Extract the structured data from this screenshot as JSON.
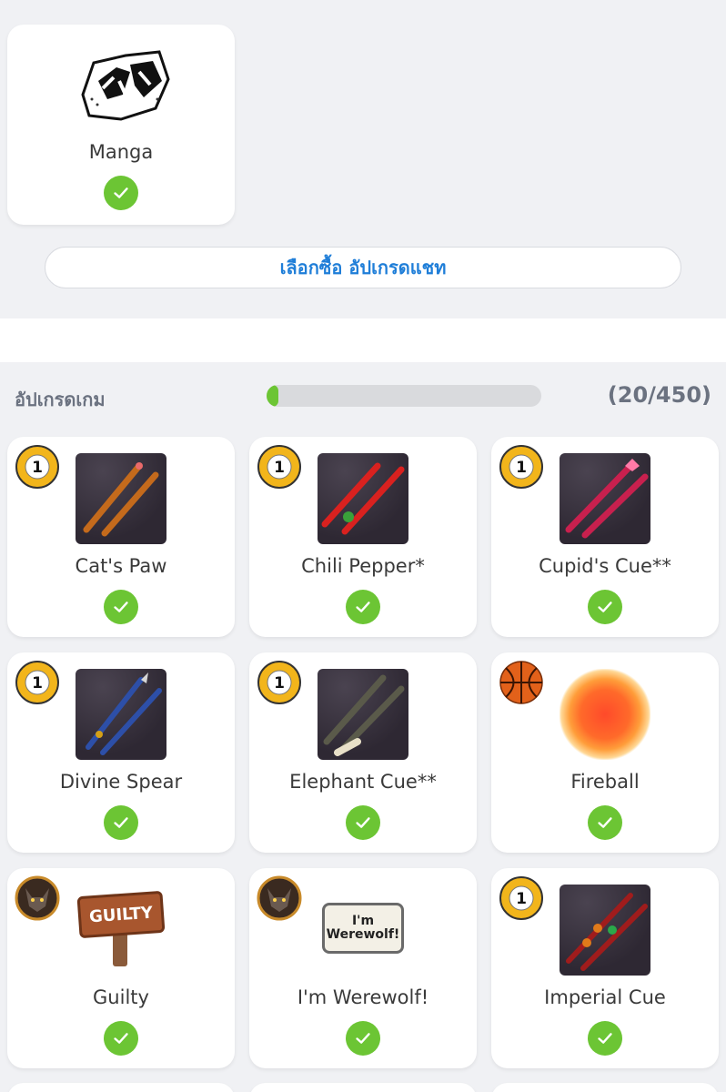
{
  "top_card": {
    "name": "Manga"
  },
  "chat_upgrade_button": "เลือกซื้อ อัปเกรดแชท",
  "game_upgrades": {
    "label": "อัปเกรดเกม",
    "count_text": "(20/450)",
    "progress_fraction": 0.044
  },
  "items": [
    {
      "name": "Cat's Paw",
      "badge": "ball-1"
    },
    {
      "name": "Chili Pepper*",
      "badge": "ball-1"
    },
    {
      "name": "Cupid's Cue**",
      "badge": "ball-1"
    },
    {
      "name": "Divine Spear",
      "badge": "ball-1"
    },
    {
      "name": "Elephant Cue**",
      "badge": "ball-1"
    },
    {
      "name": "Fireball",
      "badge": "basketball"
    },
    {
      "name": "Guilty",
      "badge": "werewolf"
    },
    {
      "name": "I'm Werewolf!",
      "badge": "werewolf"
    },
    {
      "name": "Imperial Cue",
      "badge": "ball-1"
    }
  ],
  "item_art": {
    "guilty_sign": "GUILTY",
    "werewolf_sign_line1": "I'm",
    "werewolf_sign_line2": "Werewolf!",
    "ball_number": "1"
  },
  "colors": {
    "accent_blue": "#1f7ed8",
    "check_green": "#6cc534",
    "background": "#f0f1f4"
  }
}
